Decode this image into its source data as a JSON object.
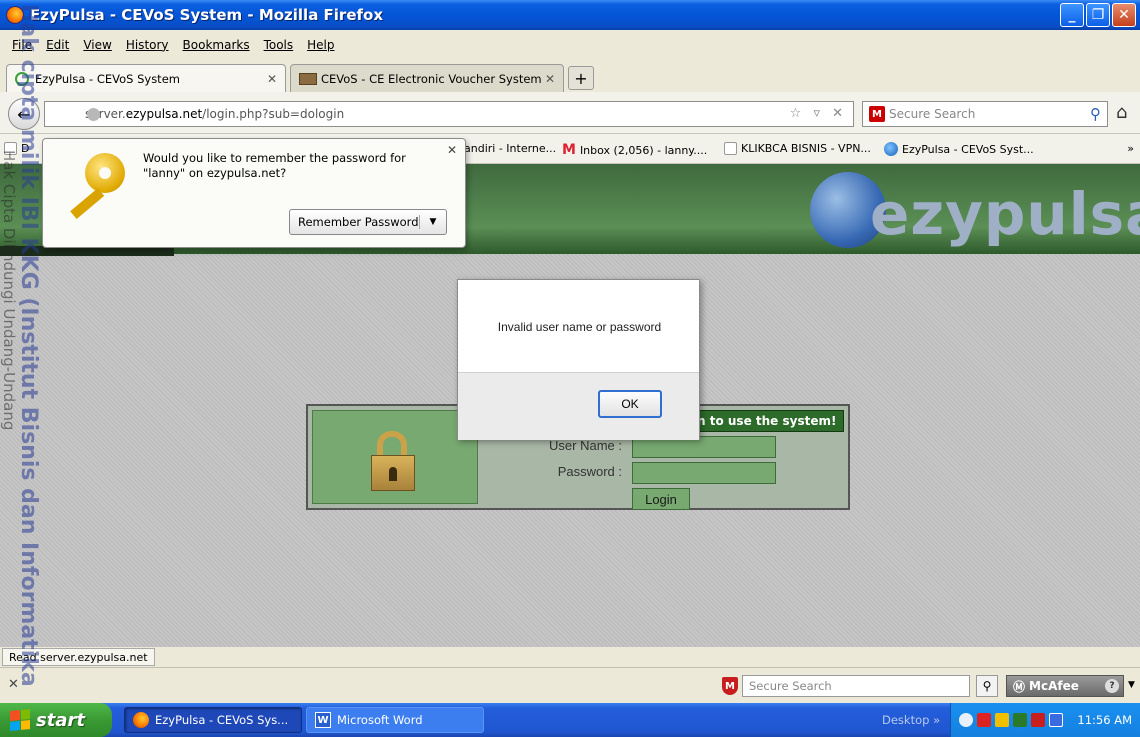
{
  "window": {
    "title": "EzyPulsa - CEVoS System - Mozilla Firefox",
    "controls": [
      "minimize-icon",
      "restore-icon",
      "close-icon"
    ]
  },
  "menu": [
    "File",
    "Edit",
    "View",
    "History",
    "Bookmarks",
    "Tools",
    "Help"
  ],
  "tabs": [
    {
      "label": "EzyPulsa - CEVoS System",
      "active": true
    },
    {
      "label": "CEVoS - CE Electronic Voucher System",
      "active": false
    }
  ],
  "nav": {
    "url_prefix": "server.",
    "url_domain": "ezypulsa.net",
    "url_path": "/login.php?sub=dologin",
    "search_placeholder": "Secure Search"
  },
  "bookmarks": [
    {
      "label": "D"
    },
    {
      "label": "andiri - Interne..."
    },
    {
      "label": "Inbox (2,056) - lanny...."
    },
    {
      "label": "KLIKBCA BISNIS - VPN..."
    },
    {
      "label": "EzyPulsa - CEVoS Syst..."
    }
  ],
  "bookmarks_more": "»",
  "password_prompt": {
    "message": "Would you like to remember the password for \"lanny\" on ezypulsa.net?",
    "button": "Remember Password"
  },
  "banner": {
    "logo_text": "ezypulsa"
  },
  "login": {
    "header": "n to use the system!",
    "username_label": "User Name :",
    "password_label": "Password :",
    "button": "Login"
  },
  "alert": {
    "message": "Invalid user name or password",
    "ok": "OK"
  },
  "status": "Read server.ezypulsa.net",
  "addon_bar": {
    "search_placeholder": "Secure Search",
    "brand": "McAfee"
  },
  "taskbar": {
    "start": "start",
    "tasks": [
      "EzyPulsa - CEVoS Sys...",
      "Microsoft Word"
    ],
    "desktop": "Desktop",
    "clock": "11:56 AM"
  },
  "watermark": {
    "line1": "Hak cipta milik IBI KKG (Institut Bisnis dan Informatika",
    "line2": "Hak Cipta Dilindungi Undang-Undang"
  }
}
